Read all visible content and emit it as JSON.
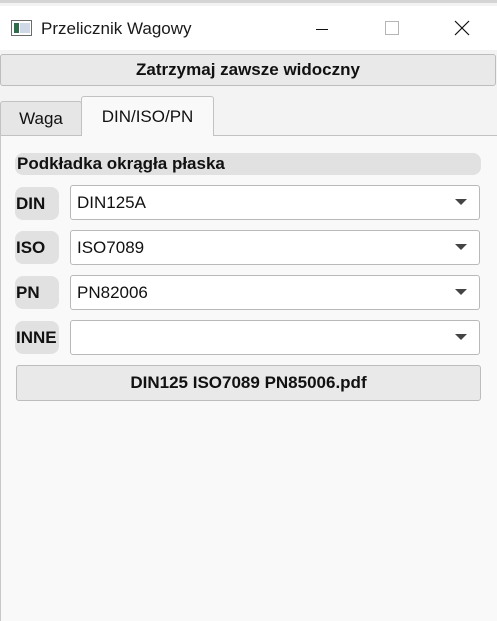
{
  "window": {
    "title": "Przelicznik Wagowy"
  },
  "toolbar": {
    "stay_on_top_label": "Zatrzymaj zawsze widoczny"
  },
  "tabs": [
    {
      "label": "Waga",
      "active": false
    },
    {
      "label": "DIN/ISO/PN",
      "active": true
    }
  ],
  "section": {
    "title": "Podkładka okrągła płaska"
  },
  "standards": [
    {
      "label": "DIN",
      "value": "DIN125A"
    },
    {
      "label": "ISO",
      "value": "ISO7089"
    },
    {
      "label": "PN",
      "value": "PN82006"
    },
    {
      "label": "INNE",
      "value": ""
    }
  ],
  "document_button": {
    "label": "DIN125 ISO7089 PN85006.pdf"
  },
  "icons": {
    "app": "app-window-icon",
    "minimize": "minimize-icon",
    "maximize": "maximize-icon",
    "close": "close-icon",
    "dropdown": "chevron-down-icon"
  }
}
